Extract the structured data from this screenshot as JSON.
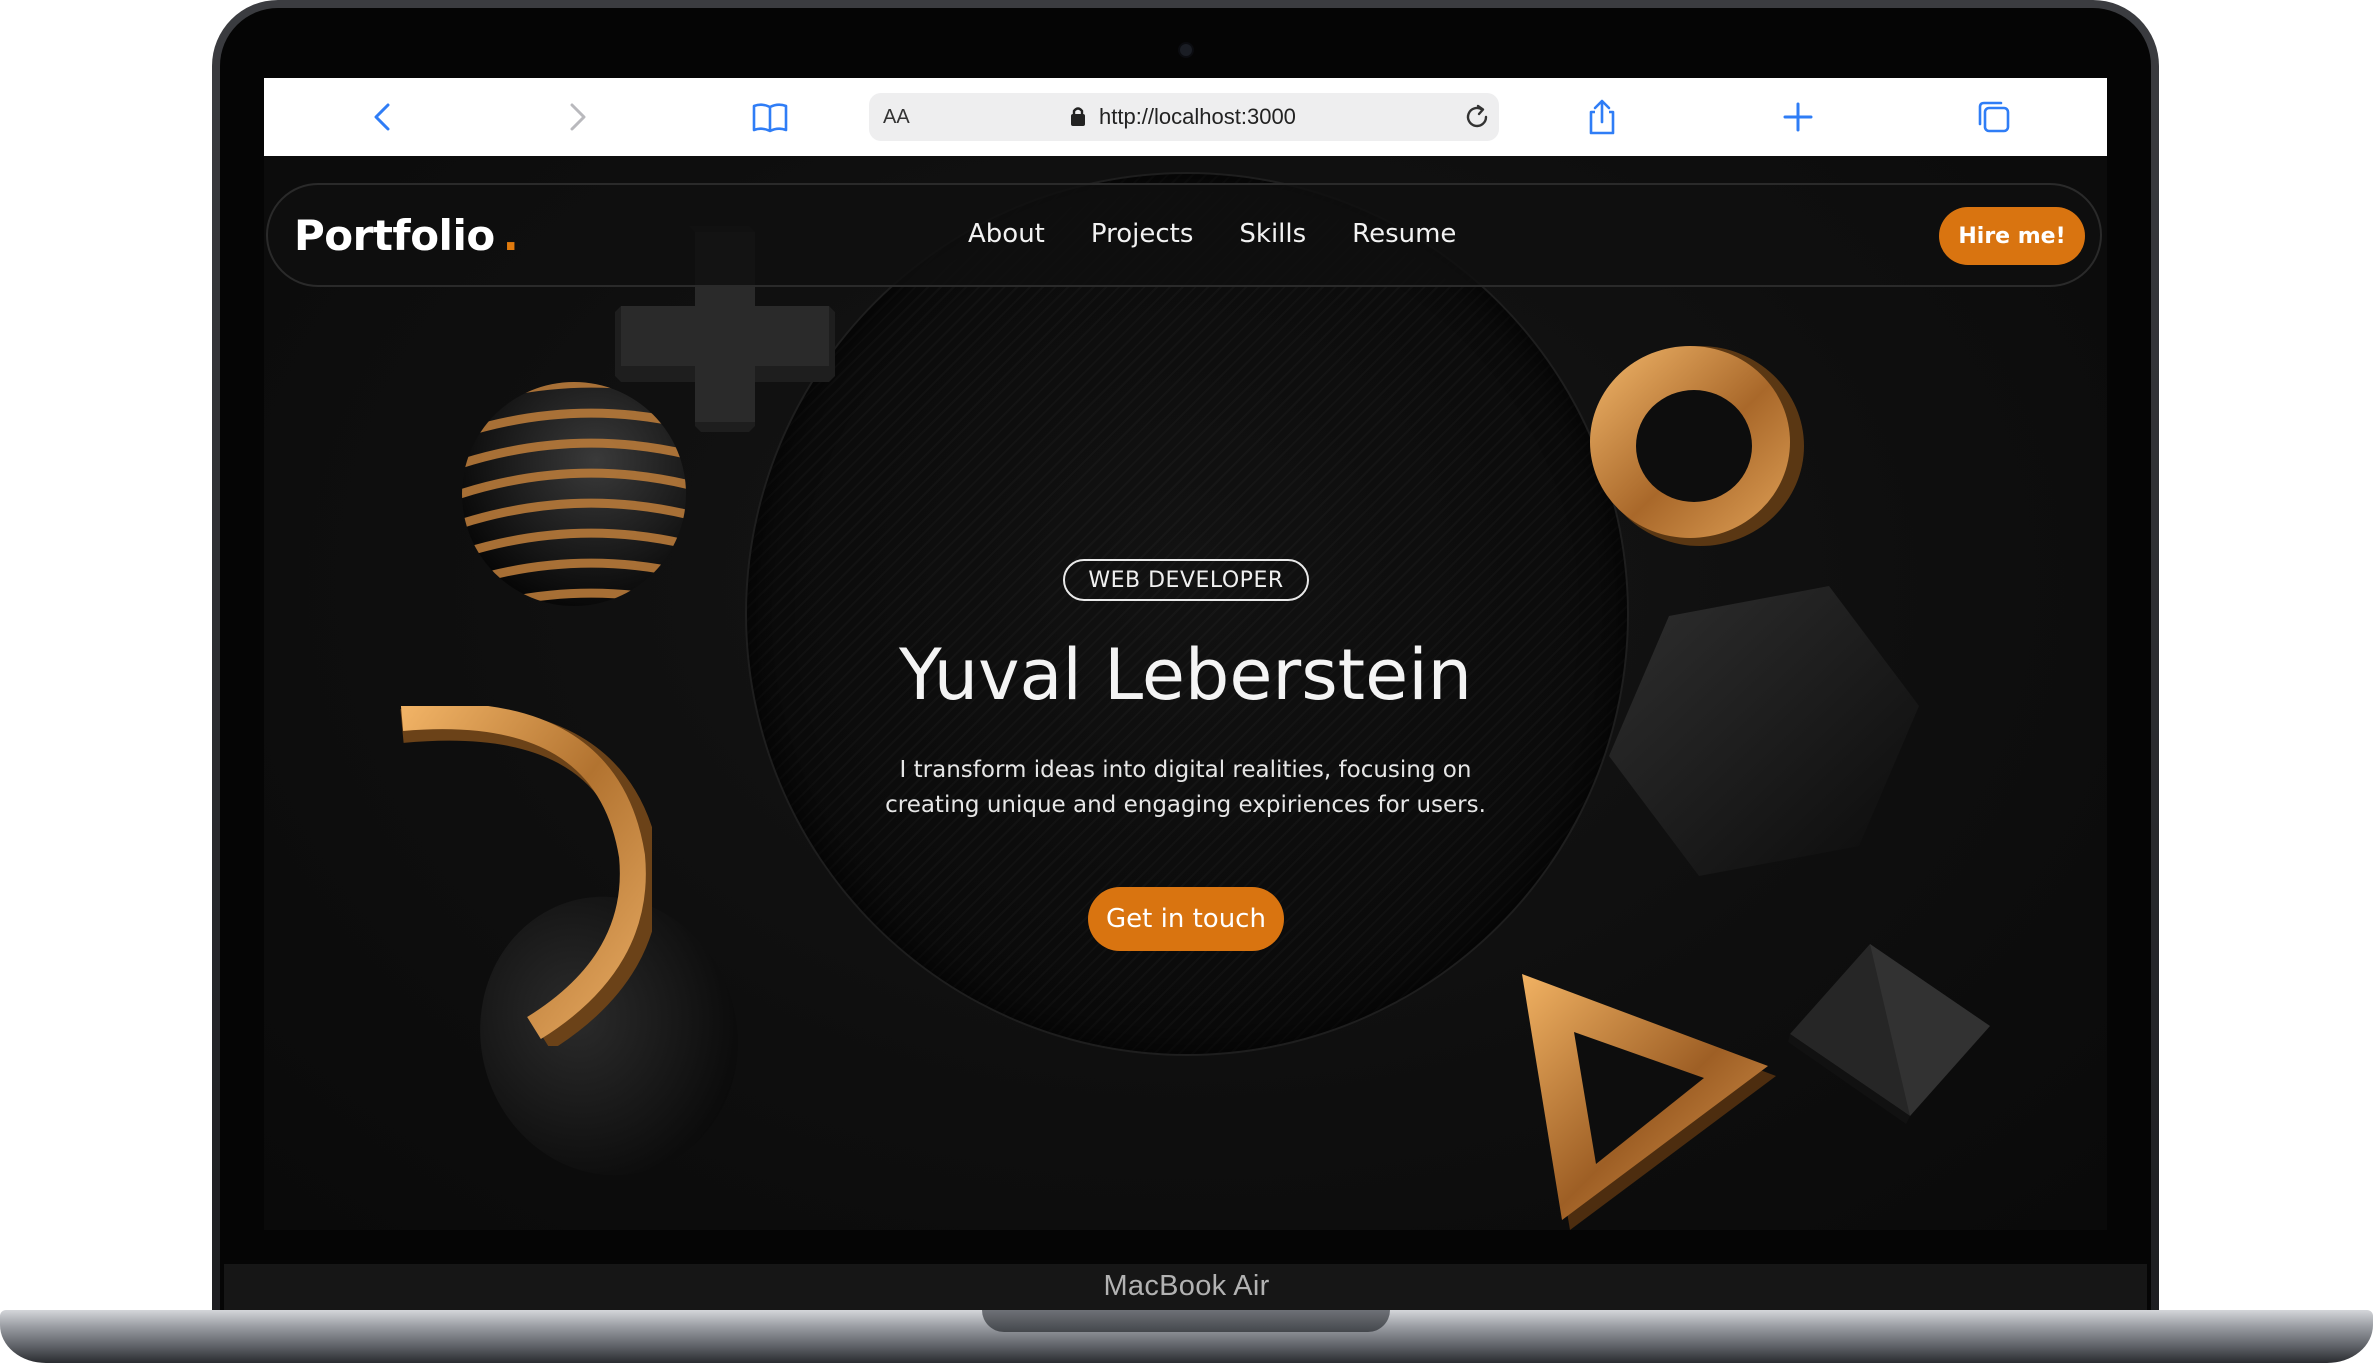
{
  "device": {
    "model_label": "MacBook Air"
  },
  "browser": {
    "reader_button": "AA",
    "url": "http://localhost:3000",
    "icons": {
      "back": "chevron-left-icon",
      "forward": "chevron-right-icon",
      "bookmarks": "book-icon",
      "lock": "lock-icon",
      "reload": "reload-icon",
      "share": "share-icon",
      "new_tab": "plus-icon",
      "tabs": "tabs-icon"
    }
  },
  "site": {
    "brand": "Portfolio",
    "brand_dot": ".",
    "nav": [
      "About",
      "Projects",
      "Skills",
      "Resume"
    ],
    "hire_button": "Hire me!",
    "hero": {
      "badge": "WEB DEVELOPER",
      "name": "Yuval Leberstein",
      "description": "I transform ideas into digital realities, focusing on creating unique and engaging expiriences for users.",
      "cta": "Get in touch"
    }
  },
  "colors": {
    "accent": "#d97410",
    "background": "#0d0d0d",
    "gold": "#c8893e",
    "text": "#f4f4f4"
  }
}
